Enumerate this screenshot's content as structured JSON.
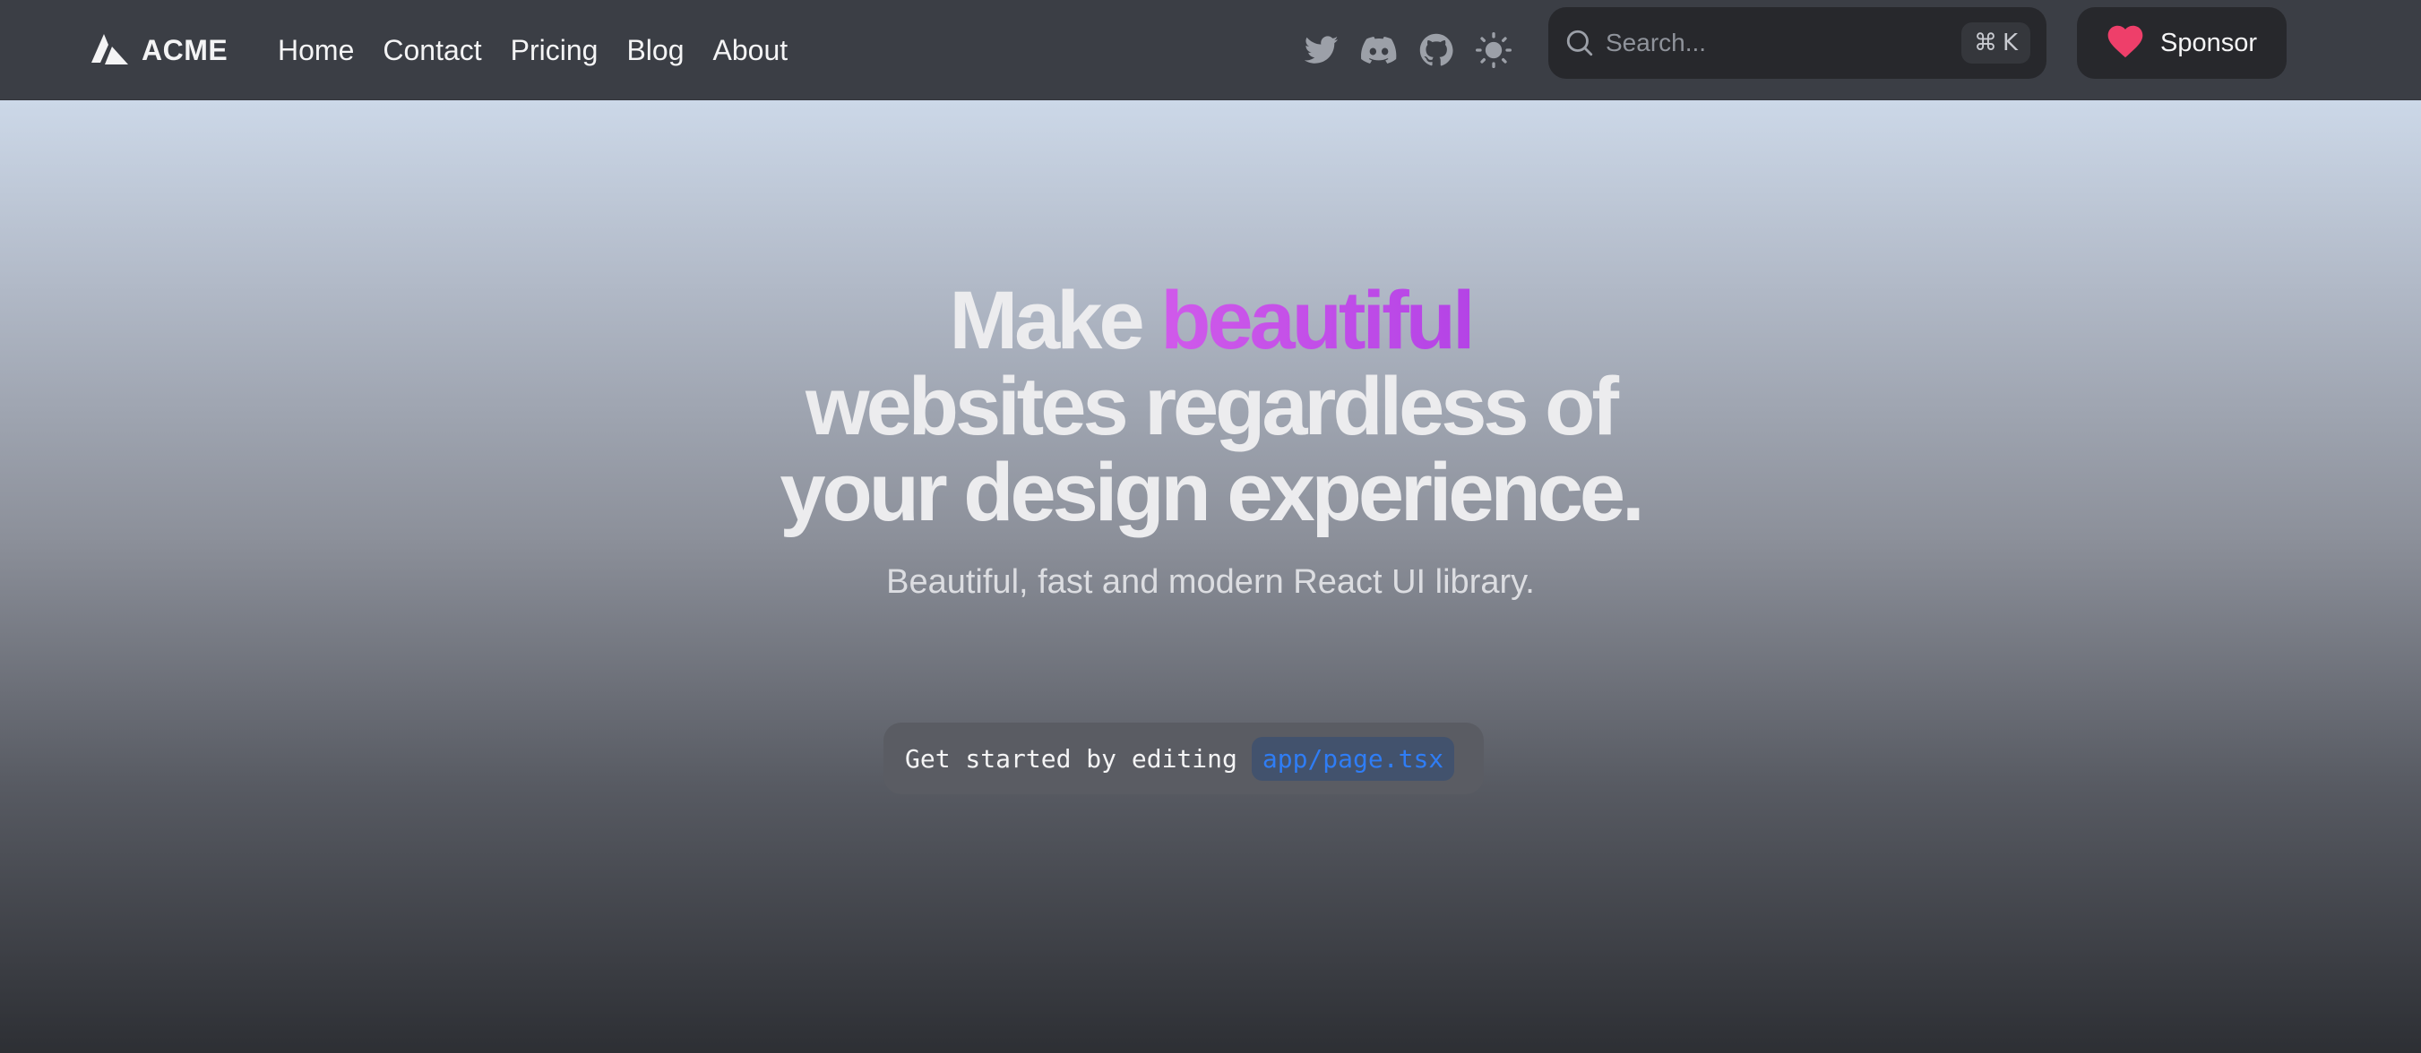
{
  "navbar": {
    "brand": "ACME",
    "links": [
      "Home",
      "Contact",
      "Pricing",
      "Blog",
      "About"
    ],
    "social_icons": [
      "twitter-icon",
      "discord-icon",
      "github-icon",
      "sun-icon"
    ],
    "search": {
      "placeholder": "Search...",
      "shortcut_symbol": "⌘",
      "shortcut_key": "K"
    },
    "sponsor_label": "Sponsor"
  },
  "hero": {
    "title_part1": "Make ",
    "title_accent": "beautiful",
    "title_line2": "websites regardless of",
    "title_line3": "your design experience.",
    "subtitle": "Beautiful, fast and modern React UI library."
  },
  "cta": {
    "text": "Get started by editing",
    "code": "app/page.tsx"
  },
  "colors": {
    "navbar_bg": "#3b3e45",
    "accent_purple": "#c04ee8",
    "heart": "#ee3f6a",
    "code_blue": "#2f7df5"
  }
}
